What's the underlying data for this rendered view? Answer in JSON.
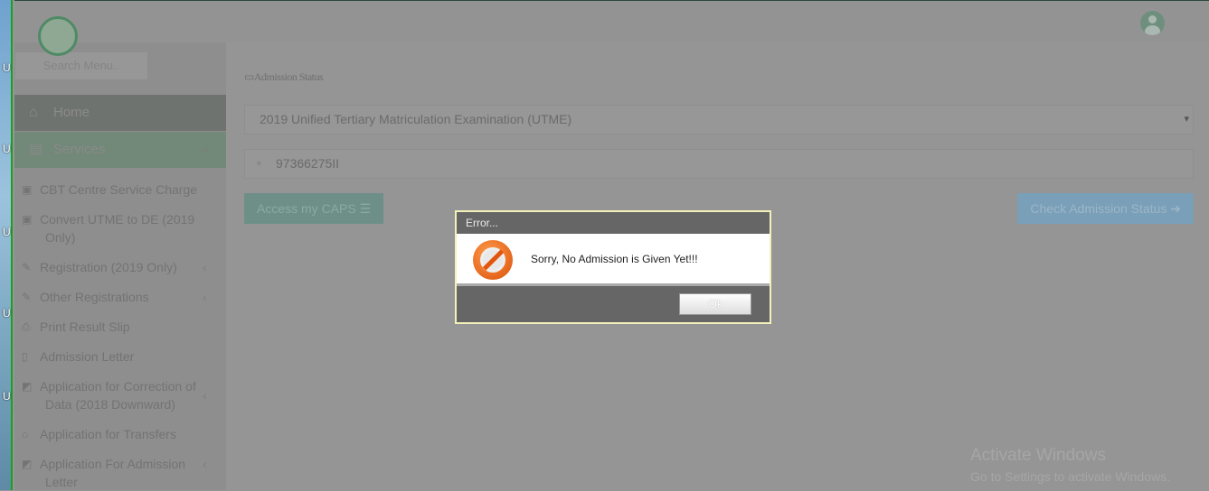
{
  "header": {
    "avatar_icon": "user-circle-icon"
  },
  "sidebar": {
    "search_placeholder": "Search Menu..",
    "home": "Home",
    "services": "Services",
    "items": [
      {
        "label": "CBT Centre Service Charge",
        "icon": "money-icon",
        "chevron": false
      },
      {
        "label": "Convert UTME to DE (2019 Only)",
        "icon": "money-icon",
        "chevron": false
      },
      {
        "label": "Registration (2019 Only)",
        "icon": "edit-icon",
        "chevron": true
      },
      {
        "label": "Other Registrations",
        "icon": "edit-icon",
        "chevron": true
      },
      {
        "label": "Print Result Slip",
        "icon": "print-icon",
        "chevron": false
      },
      {
        "label": "Admission Letter",
        "icon": "file-icon",
        "chevron": false
      },
      {
        "label": "Application for Correction of Data (2018 Downward)",
        "icon": "pencil-square-icon",
        "chevron": true
      },
      {
        "label": "Application for Transfers",
        "icon": "bank-icon",
        "chevron": false
      },
      {
        "label": "Application For Admission Letter",
        "icon": "pencil-square-icon",
        "chevron": true
      }
    ]
  },
  "main": {
    "breadcrumb": "Admission Status",
    "exam_select": "2019 Unified Tertiary Matriculation Examination (UTME)",
    "reg_number": "97366275II",
    "caps_button": "Access my CAPS",
    "check_button": "Check Admission Status"
  },
  "dialog": {
    "title": "Error...",
    "message": "Sorry, No Admission is Given Yet!!!",
    "ok": "Ok"
  },
  "watermark": {
    "line1": "Activate Windows",
    "line2": "Go to Settings to activate Windows."
  },
  "colors": {
    "accent": "#6e8f87",
    "check": "#7a9fb8",
    "dialog_border": "#f1f1b9"
  }
}
